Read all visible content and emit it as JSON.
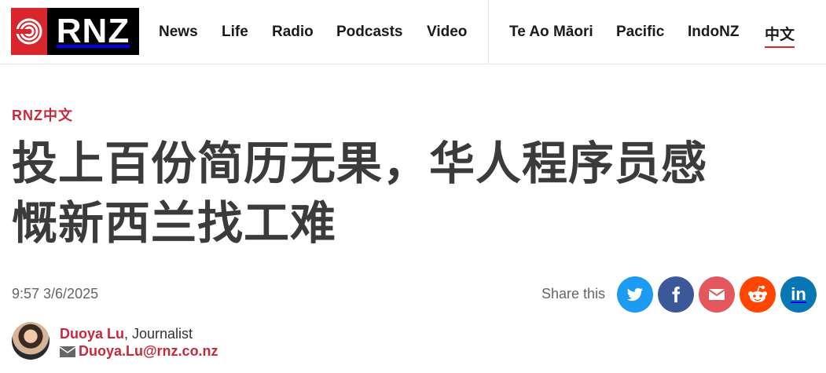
{
  "header": {
    "logo_text": "RNZ",
    "nav_primary": [
      "News",
      "Life",
      "Radio",
      "Podcasts",
      "Video"
    ],
    "nav_secondary": [
      "Te Ao Māori",
      "Pacific",
      "IndoNZ",
      "中文"
    ],
    "active_nav": "中文"
  },
  "article": {
    "kicker": "RNZ中文",
    "headline_line1": "投上百份简历无果，华人程序员感",
    "headline_line2": "慨新西兰找工难",
    "timestamp": "9:57 3/6/2025",
    "share_label": "Share this",
    "share_buttons": [
      {
        "name": "twitter",
        "icon": "twitter-icon",
        "color": "#1d9bf0"
      },
      {
        "name": "facebook",
        "icon": "facebook-icon",
        "color": "#3b5998"
      },
      {
        "name": "email",
        "icon": "mail-icon",
        "color": "#e5565d"
      },
      {
        "name": "reddit",
        "icon": "reddit-icon",
        "color": "#ff4500"
      },
      {
        "name": "linkedin",
        "icon": "linkedin-icon",
        "color": "#0a77b5"
      }
    ]
  },
  "author": {
    "name": "Duoya Lu",
    "role": ", Journalist",
    "email": "Duoya.Lu@rnz.co.nz"
  }
}
